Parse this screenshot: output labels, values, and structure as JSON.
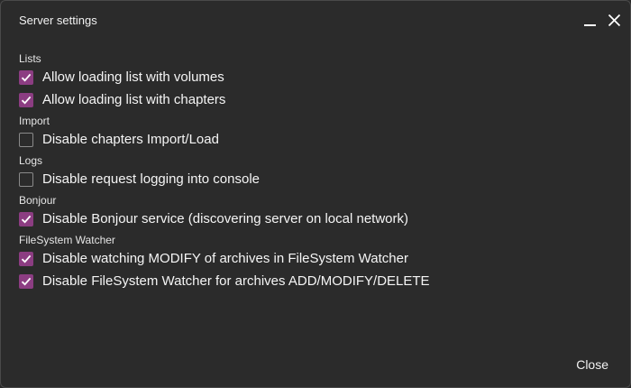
{
  "window": {
    "title": "Server settings"
  },
  "groups": [
    {
      "label": "Lists",
      "options": [
        {
          "label": "Allow loading list with volumes",
          "checked": true
        },
        {
          "label": "Allow loading list with chapters",
          "checked": true
        }
      ]
    },
    {
      "label": "Import",
      "options": [
        {
          "label": "Disable chapters Import/Load",
          "checked": false
        }
      ]
    },
    {
      "label": "Logs",
      "options": [
        {
          "label": "Disable request logging into console",
          "checked": false
        }
      ]
    },
    {
      "label": "Bonjour",
      "options": [
        {
          "label": "Disable Bonjour service (discovering server on local network)",
          "checked": true
        }
      ]
    },
    {
      "label": "FileSystem Watcher",
      "options": [
        {
          "label": "Disable watching MODIFY of archives in FileSystem Watcher",
          "checked": true
        },
        {
          "label": "Disable FileSystem Watcher for archives ADD/MODIFY/DELETE",
          "checked": true
        }
      ]
    }
  ],
  "footer": {
    "close_label": "Close"
  },
  "colors": {
    "accent": "#8c3d82",
    "background": "#2b2b2b"
  },
  "icons": {
    "minimize": "minimize-icon",
    "close": "close-icon",
    "check": "checkmark-icon"
  }
}
